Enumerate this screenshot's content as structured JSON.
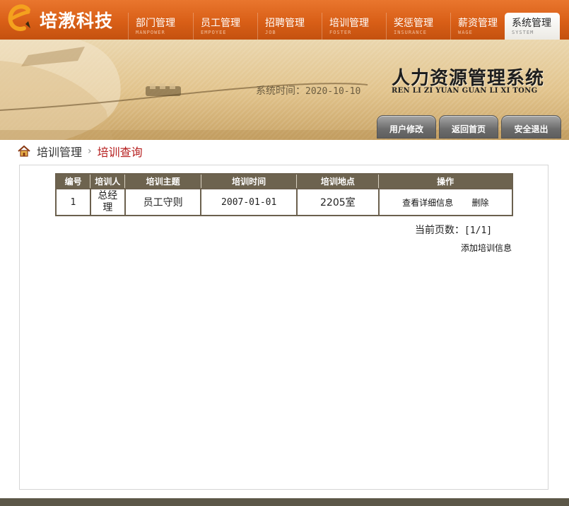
{
  "brand": {
    "name": "培漖科技",
    "logo": "e-logo-icon"
  },
  "nav": [
    {
      "cn": "部门管理",
      "en": "MANPOWER"
    },
    {
      "cn": "员工管理",
      "en": "EMPOYEE"
    },
    {
      "cn": "招聘管理",
      "en": "JOB"
    },
    {
      "cn": "培训管理",
      "en": "FOSTER"
    },
    {
      "cn": "奖惩管理",
      "en": "INSURANCE"
    },
    {
      "cn": "薪资管理",
      "en": "WAGE"
    },
    {
      "cn": "系统管理",
      "en": "SYSTEM",
      "active": true
    }
  ],
  "banner": {
    "title": "人力资源管理系统",
    "subtitle": "REN LI ZI YUAN GUAN LI XI TONG",
    "time_label": "系统时间：",
    "time_value": "2020-10-10",
    "buttons": [
      "用户修改",
      "返回首页",
      "安全退出"
    ]
  },
  "breadcrumb": {
    "icon": "home-icon",
    "parent": "培训管理",
    "separator": "›",
    "current": "培训查询"
  },
  "table": {
    "headers": [
      "编号",
      "培训人",
      "培训主题",
      "培训时间",
      "培训地点",
      "操作"
    ],
    "rows": [
      {
        "id": "1",
        "trainer": "总经理",
        "topic": "员工守则",
        "date": "2007-01-01",
        "place": "2205室",
        "view": "查看详细信息",
        "delete": "删除"
      }
    ]
  },
  "pager": {
    "label": "当前页数：",
    "value": "[1/1]"
  },
  "add_link": "添加培训信息",
  "colors": {
    "header": "#d95f17",
    "table_header": "#6d634f",
    "breadcrumb_current": "#b51c1c",
    "footer": "#5c5748"
  }
}
